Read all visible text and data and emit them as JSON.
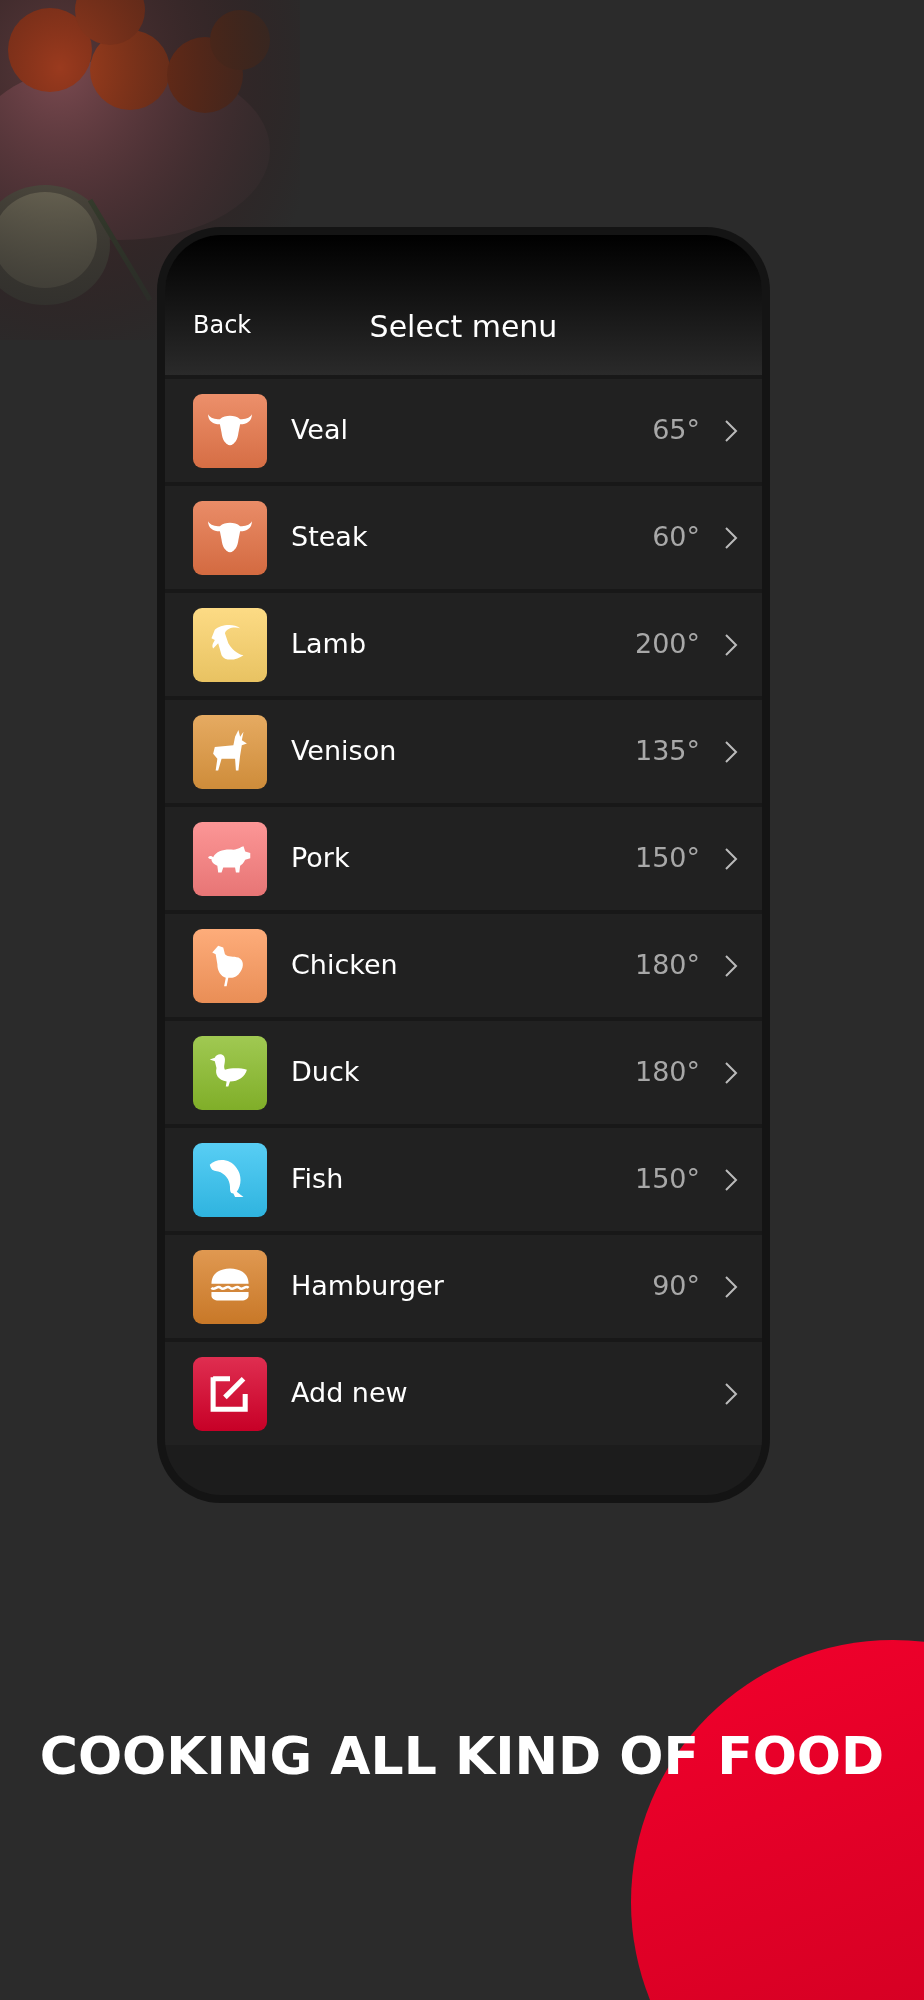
{
  "header": {
    "back": "Back",
    "title": "Select menu"
  },
  "items": [
    {
      "kind": "bull",
      "name": "Veal",
      "temperature": "65°",
      "color": "#e8774a"
    },
    {
      "kind": "bull",
      "name": "Steak",
      "temperature": "60°",
      "color": "#e57346"
    },
    {
      "kind": "goat",
      "name": "Lamb",
      "temperature": "200°",
      "color": "#fcd36a"
    },
    {
      "kind": "deer",
      "name": "Venison",
      "temperature": "135°",
      "color": "#e0983f"
    },
    {
      "kind": "pig",
      "name": "Pork",
      "temperature": "150°",
      "color": "#fb7f7f"
    },
    {
      "kind": "hen",
      "name": "Chicken",
      "temperature": "180°",
      "color": "#fd9a5d"
    },
    {
      "kind": "duck",
      "name": "Duck",
      "temperature": "180°",
      "color": "#8bbd2c"
    },
    {
      "kind": "fish",
      "name": "Fish",
      "temperature": "150°",
      "color": "#33c3f2"
    },
    {
      "kind": "burger",
      "name": "Hamburger",
      "temperature": "90°",
      "color": "#d9822b"
    },
    {
      "kind": "edit",
      "name": "Add new",
      "color": "#d8002a"
    }
  ],
  "headline": "COOKING ALL KIND OF FOOD"
}
